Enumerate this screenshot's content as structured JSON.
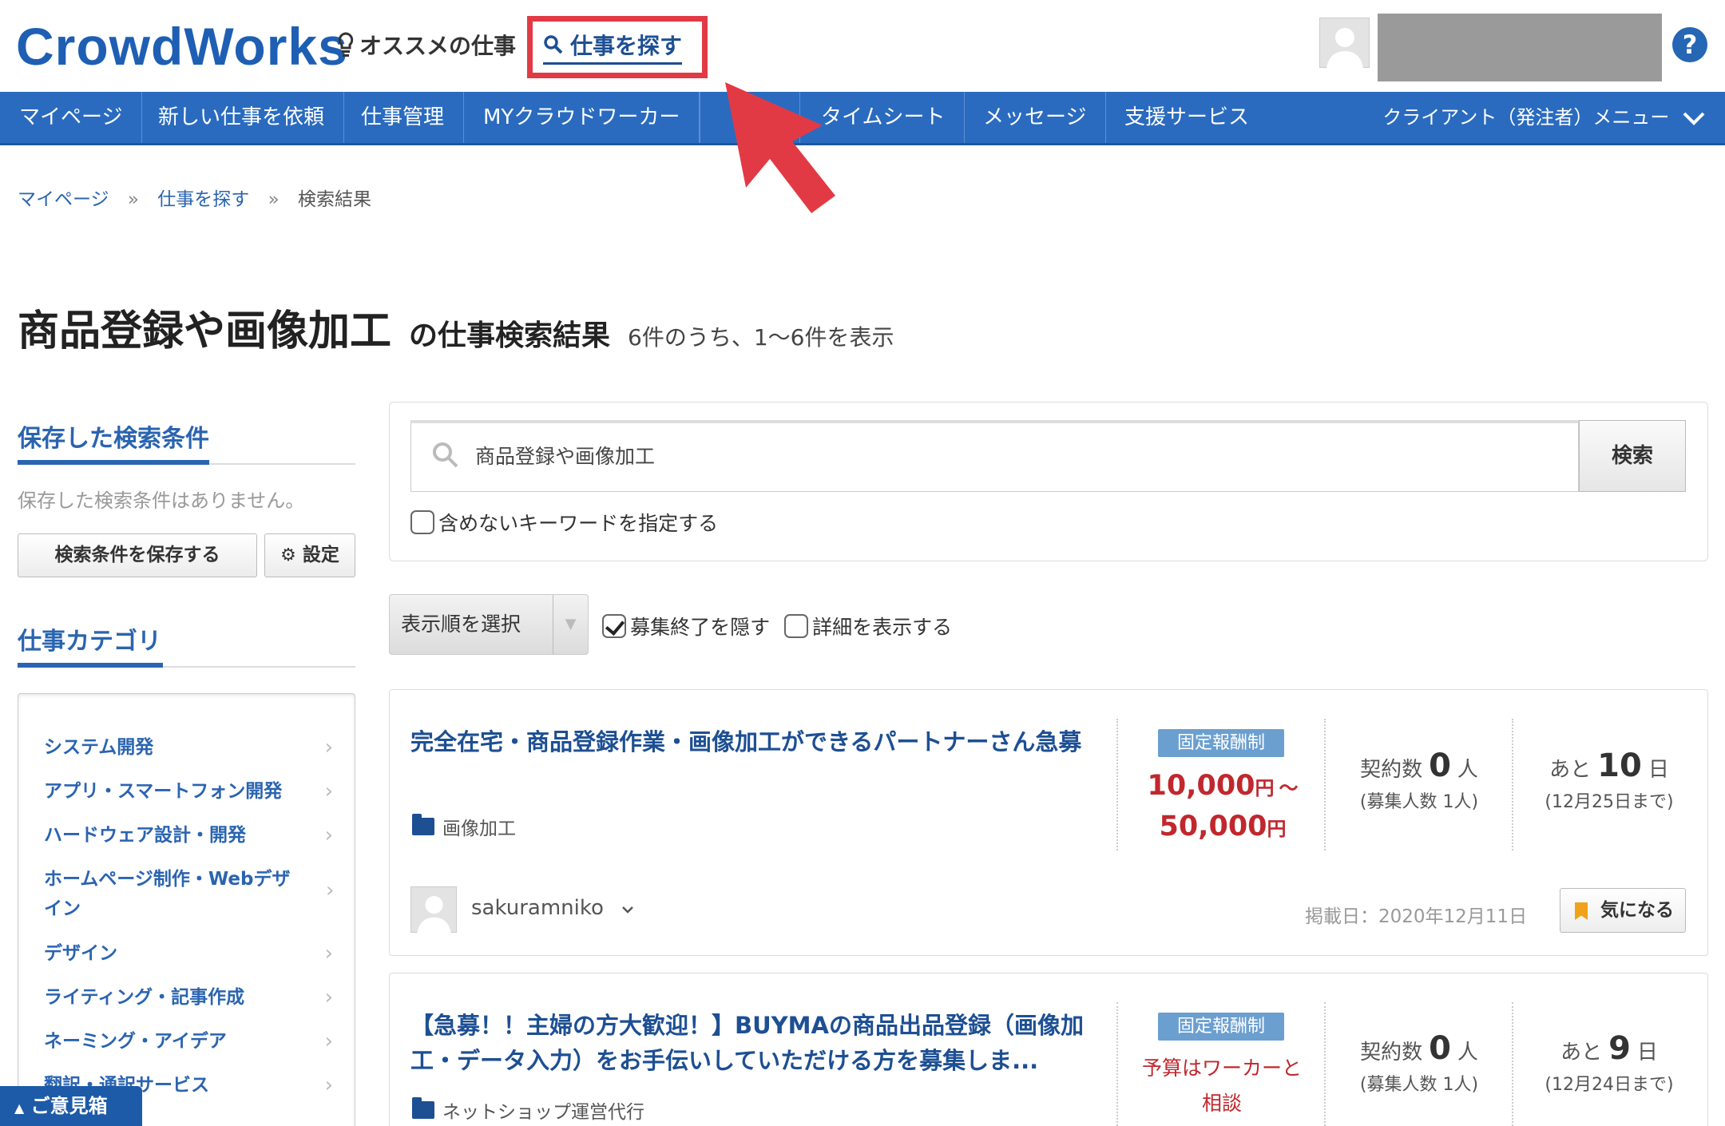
{
  "header": {
    "logo": "CrowdWorks",
    "recommend_label": "オススメの仕事",
    "find_label": "仕事を探す",
    "help_label": "?"
  },
  "nav": {
    "items": [
      "マイページ",
      "新しい仕事を依頼",
      "仕事管理",
      "MYクラウドワーカー",
      "タイムシート",
      "メッセージ",
      "支援サービス"
    ],
    "right_menu": "クライアント（発注者）メニュー"
  },
  "breadcrumb": [
    "マイページ",
    "仕事を探す",
    "検索結果"
  ],
  "title": {
    "keyword": "商品登録や画像加工",
    "suffix": "の仕事検索結果",
    "count": "6件のうち、1〜6件を表示"
  },
  "sidebar": {
    "saved_heading": "保存した検索条件",
    "saved_empty": "保存した検索条件はありません。",
    "save_button": "検索条件を保存する",
    "settings_button": "設定",
    "category_heading": "仕事カテゴリ",
    "categories": [
      "システム開発",
      "アプリ・スマートフォン開発",
      "ハードウェア設計・開発",
      "ホームページ制作・Webデザイン",
      "デザイン",
      "ライティング・記事作成",
      "ネーミング・アイデア",
      "翻訳・通訳サービス"
    ],
    "feedback": "ご意見箱"
  },
  "search": {
    "query": "商品登録や画像加工",
    "button": "検索",
    "exclude_label": "含めないキーワードを指定する",
    "sort_placeholder": "表示順を選択",
    "hide_closed_label": "募集終了を隠す",
    "hide_closed_checked": true,
    "show_details_label": "詳細を表示する",
    "show_details_checked": false
  },
  "jobs": [
    {
      "title": "完全在宅・商品登録作業・画像加工ができるパートナーさん急募",
      "category": "画像加工",
      "pay_type": "固定報酬制",
      "price_from": "10,000",
      "price_to": "50,000",
      "yen": "円",
      "range_mark": "〜",
      "contracts_label": "契約数",
      "contracts": "0",
      "person_unit": "人",
      "recruit": "(募集人数 1人)",
      "remaining_prefix": "あと",
      "remaining_days": "10",
      "day_unit": "日",
      "deadline": "(12月25日まで)",
      "poster": "sakuramniko",
      "posted": "掲載日：2020年12月11日",
      "fav": "気になる"
    },
    {
      "title": "【急募！！主婦の方大歓迎！】BUYMAの商品出品登録（画像加工・データ入力）をお手伝いしていただける方を募集しま...",
      "category": "ネットショップ運営代行",
      "pay_type": "固定報酬制",
      "price_text": "予算はワーカーと相談",
      "contracts_label": "契約数",
      "contracts": "0",
      "person_unit": "人",
      "recruit": "(募集人数 1人)",
      "remaining_prefix": "あと",
      "remaining_days": "9",
      "day_unit": "日",
      "deadline": "(12月24日まで)"
    }
  ],
  "colors": {
    "brand": "#1e5fb4",
    "nav_bg": "#2a6bc0",
    "annotation": "#e23a44",
    "price": "#c0282e"
  }
}
